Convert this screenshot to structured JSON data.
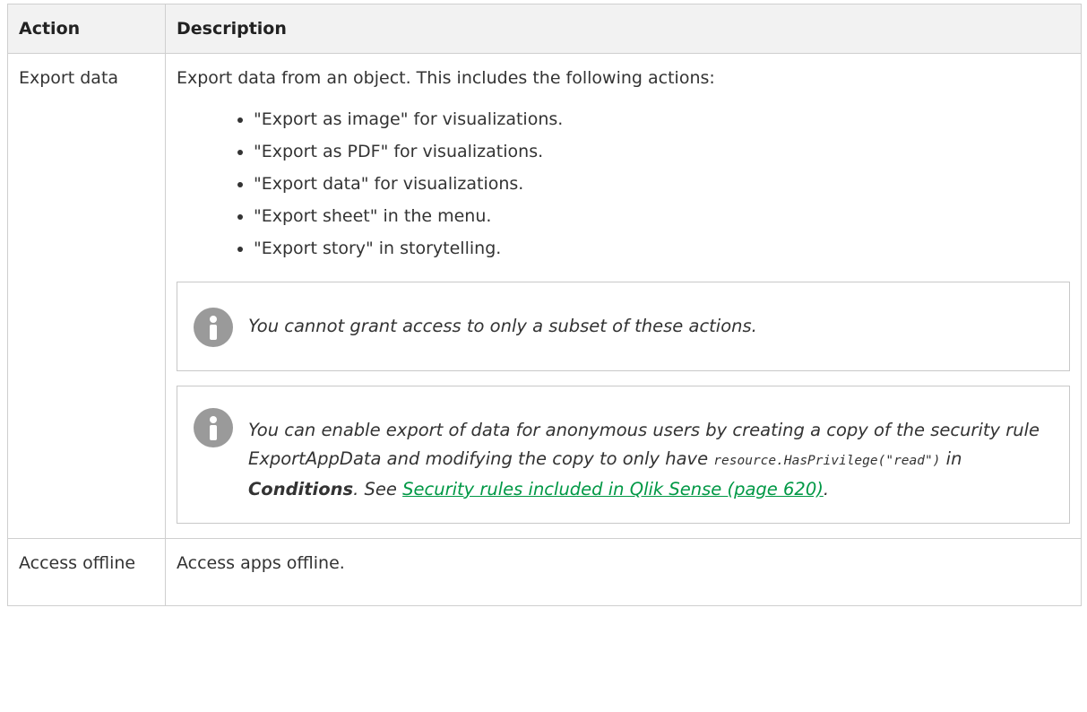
{
  "table": {
    "headers": [
      "Action",
      "Description"
    ],
    "rows": [
      {
        "action": "Export data",
        "description": "Export data from an object. This includes the following actions:",
        "bullets": [
          "\"Export as image\" for visualizations.",
          "\"Export as PDF\" for visualizations.",
          "\"Export data\" for visualizations.",
          "\"Export sheet\" in the menu.",
          "\"Export story\" in storytelling."
        ],
        "note1": "You cannot grant access to only a subset of these actions.",
        "note2": {
          "text_before": "You can enable export of data for anonymous users by creating a copy of the security rule ExportAppData and modifying the copy to only have",
          "code": "resource.HasPrivilege(\"read\")",
          "text_in": "in",
          "bold": "Conditions",
          "text_see": ". See",
          "link": "Security rules included in Qlik Sense (page 620)",
          "text_after": "."
        }
      },
      {
        "action": "Access offline",
        "description": "Access apps offline."
      }
    ]
  },
  "colors": {
    "header_bg": "#f2f2f2",
    "border": "#cfcfcf",
    "link": "#009845",
    "icon": "#9a9a9a"
  },
  "icons": {
    "note_icon": "info-icon"
  }
}
